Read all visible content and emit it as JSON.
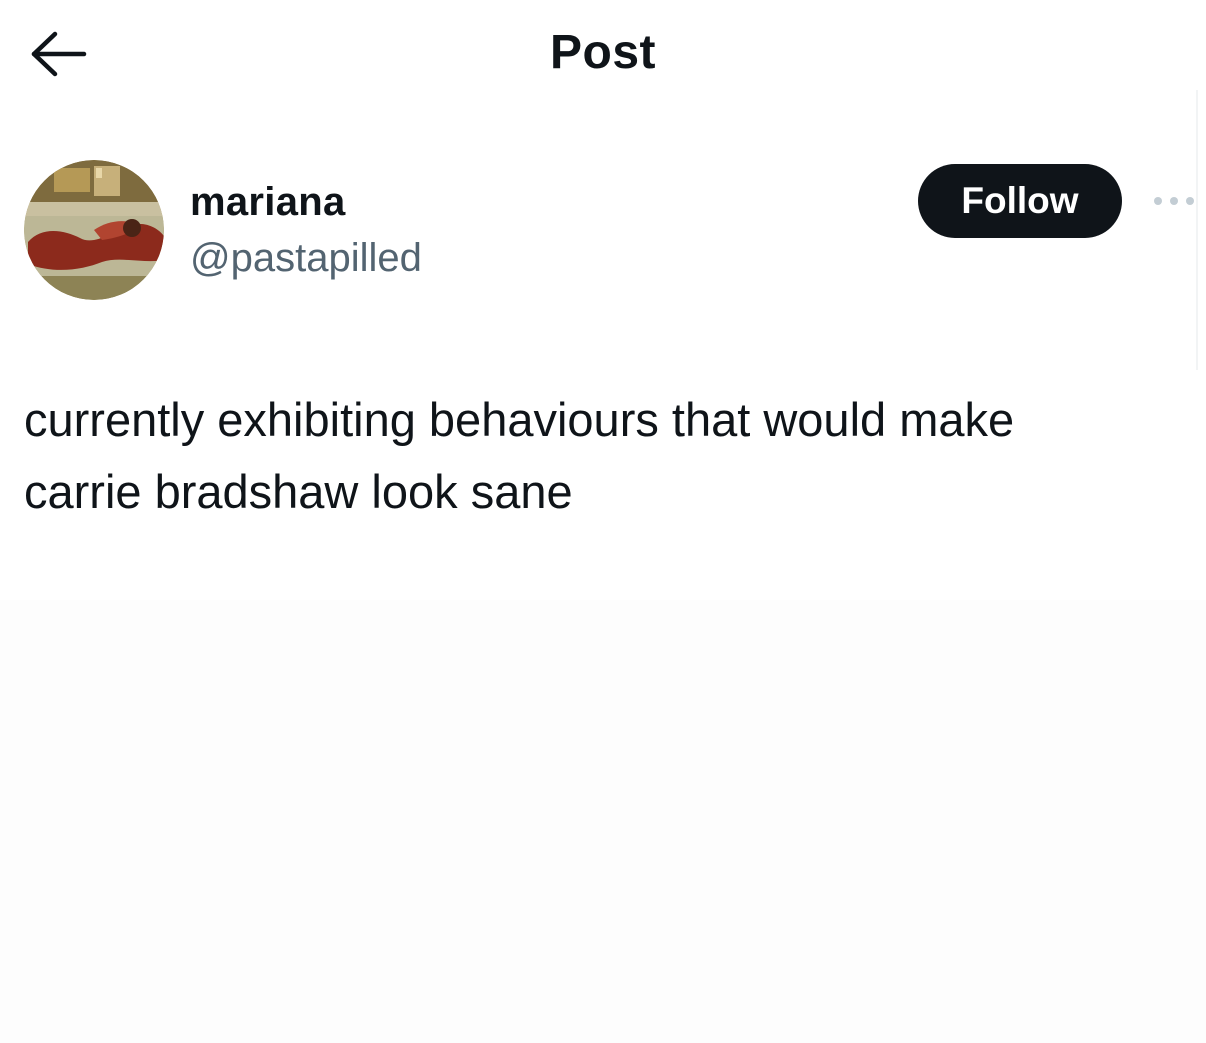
{
  "header": {
    "title": "Post",
    "back_icon": "arrow-left-icon"
  },
  "author": {
    "display_name": "mariana",
    "handle": "@pastapilled",
    "avatar_icon": "user-avatar"
  },
  "actions": {
    "follow_label": "Follow",
    "more_icon": "more-horizontal-icon"
  },
  "post": {
    "text": "currently exhibiting behaviours that would make\ncarrie bradshaw look sane"
  },
  "colors": {
    "text_primary": "#0f1419",
    "text_secondary": "#536471",
    "follow_button_bg": "#0f1419",
    "follow_button_text": "#ffffff",
    "background": "#ffffff"
  }
}
